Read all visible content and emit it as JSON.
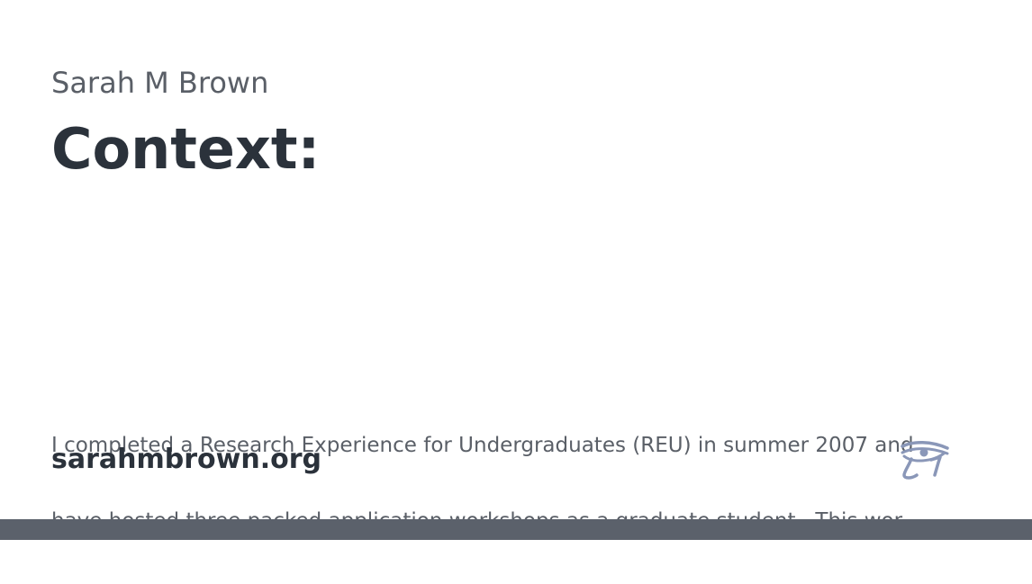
{
  "card": {
    "author": "Sarah M Brown",
    "title": "Context:",
    "description_lines": [
      "I completed a Research Experience for Undergraduates (REU) in summer 2007 and",
      "have hosted three packed application workshops as a graduate student.  This wor..."
    ],
    "site": "sarahmbrown.org",
    "logo_icon": "eye-of-horus-icon"
  },
  "colors": {
    "background": "#ffffff",
    "title": "#2b323b",
    "body_text": "#5a5f67",
    "logo": "#8a97b8",
    "footer_bar": "#5b616b"
  }
}
